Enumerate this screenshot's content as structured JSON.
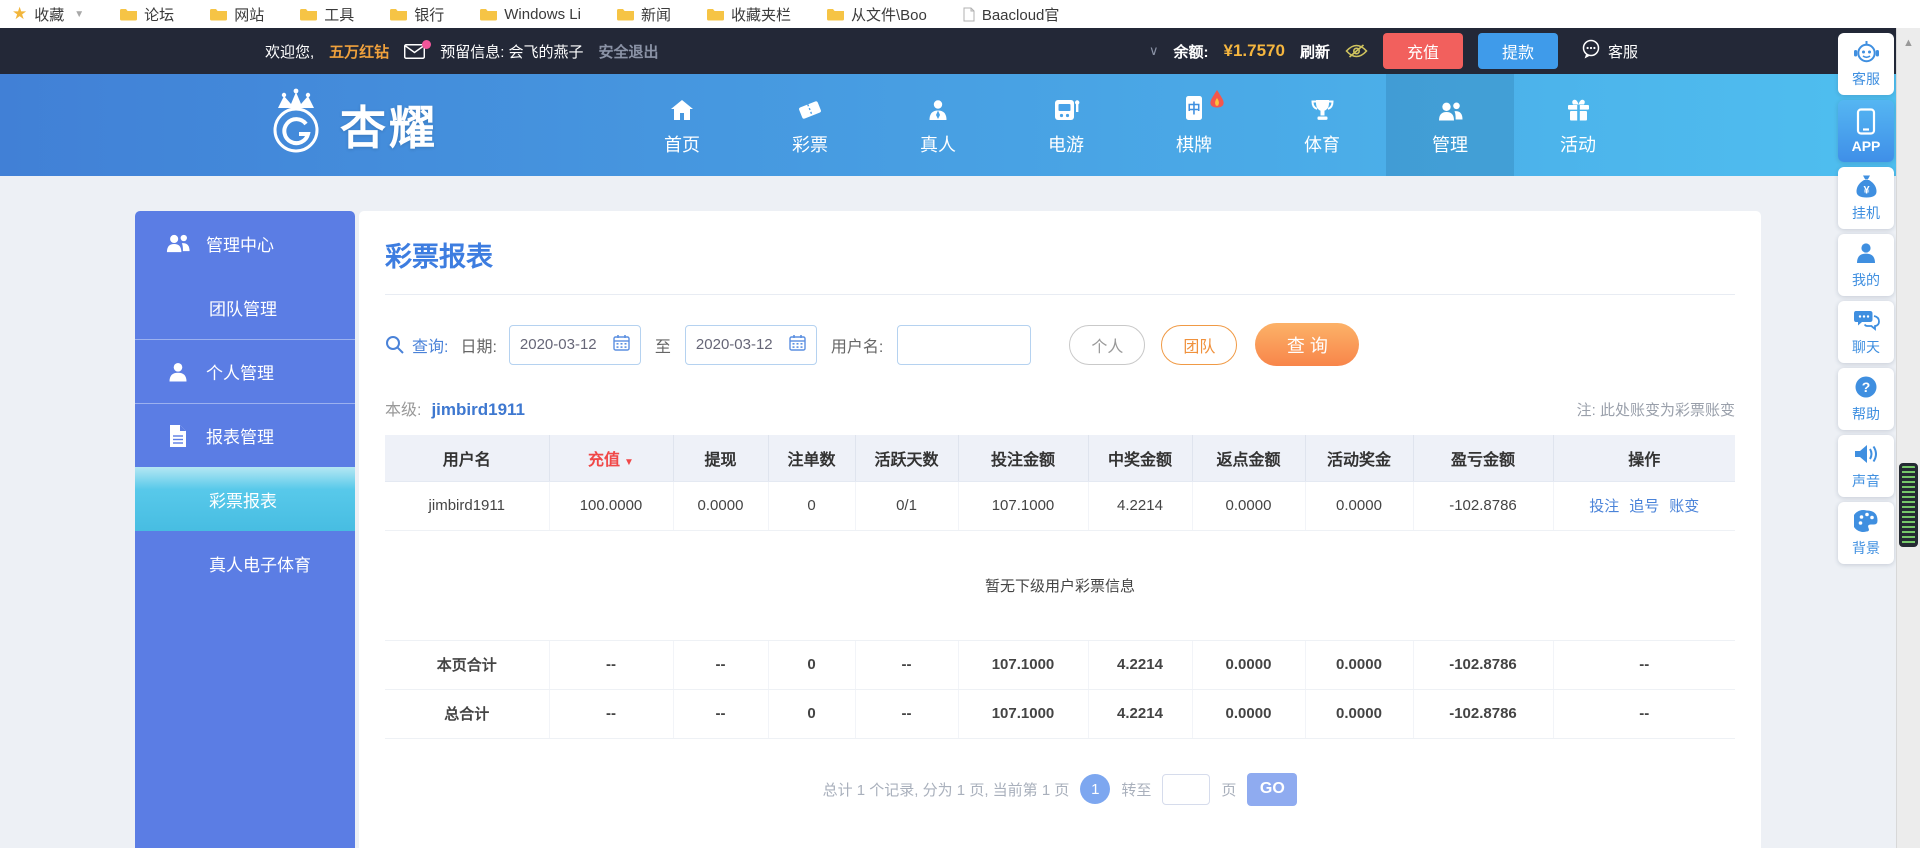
{
  "bookmarks": {
    "star_item": "收藏",
    "folders": [
      "论坛",
      "网站",
      "工具",
      "银行",
      "Windows Li",
      "新闻",
      "收藏夹栏",
      "从文件\\Boo"
    ],
    "page_item": "Baacloud官",
    "folder_icon": "folder-icon",
    "page_icon": "page-icon"
  },
  "topbar": {
    "welcome": "欢迎您,",
    "vip": "五万红钻",
    "mail_icon": "envelope-icon",
    "reserved": "预留信息: 会飞的燕子",
    "logout": "安全退出",
    "chevron_icon": "chevron-down-icon",
    "balance_label": "余额:",
    "balance_value": "¥1.7570",
    "refresh": "刷新",
    "eye_icon": "eye-slash-icon",
    "recharge": "充值",
    "withdraw": "提款",
    "service": "客服",
    "service_icon": "chat-bubble-icon",
    "colors": {
      "recharge": "#f2605d",
      "withdraw": "#3f9bea",
      "balance": "#f5b63f"
    }
  },
  "nav": {
    "logo_text": "杏耀",
    "logo_icon": "crown-emblem-icon",
    "items": [
      {
        "id": "home",
        "label": "首页",
        "icon": "home-icon"
      },
      {
        "id": "lottery",
        "label": "彩票",
        "icon": "ticket-icon"
      },
      {
        "id": "live",
        "label": "真人",
        "icon": "dealer-icon"
      },
      {
        "id": "egame",
        "label": "电游",
        "icon": "slot-icon"
      },
      {
        "id": "board",
        "label": "棋牌",
        "icon": "mahjong-icon",
        "badge": "hot-flame-icon"
      },
      {
        "id": "sports",
        "label": "体育",
        "icon": "trophy-icon"
      },
      {
        "id": "manage",
        "label": "管理",
        "icon": "team-icon",
        "active": true
      },
      {
        "id": "activity",
        "label": "活动",
        "icon": "gift-icon"
      }
    ]
  },
  "sidebar": {
    "items": [
      {
        "id": "manage-center",
        "label": "管理中心",
        "icon": "team-icon",
        "type": "group"
      },
      {
        "id": "team-manage",
        "label": "团队管理",
        "type": "sub"
      },
      {
        "id": "personal-manage",
        "label": "个人管理",
        "icon": "person-icon",
        "type": "group",
        "divided": true
      },
      {
        "id": "report-manage",
        "label": "报表管理",
        "icon": "report-icon",
        "type": "group",
        "divided": true
      },
      {
        "id": "lottery-report",
        "label": "彩票报表",
        "type": "sub",
        "active": true
      },
      {
        "id": "live-esports",
        "label": "真人电子体育",
        "type": "sub"
      }
    ]
  },
  "floatbar": {
    "items": [
      {
        "id": "service",
        "label": "客服",
        "icon": "service-robot-icon"
      },
      {
        "id": "app",
        "label": "APP",
        "icon": "phone-icon",
        "active": true
      },
      {
        "id": "hangup",
        "label": "挂机",
        "icon": "moneybag-icon"
      },
      {
        "id": "mine",
        "label": "我的",
        "icon": "user-icon"
      },
      {
        "id": "chat",
        "label": "聊天",
        "icon": "chat-bubbles-icon"
      },
      {
        "id": "help",
        "label": "帮助",
        "icon": "help-icon"
      },
      {
        "id": "sound",
        "label": "声音",
        "icon": "sound-icon"
      },
      {
        "id": "background",
        "label": "背景",
        "icon": "palette-icon"
      }
    ]
  },
  "main": {
    "title": "彩票报表",
    "search": {
      "search_icon": "search-icon",
      "calendar_icon": "calendar-icon",
      "query_label": "查询:",
      "date_label": "日期:",
      "date_from": "2020-03-12",
      "to_label": "至",
      "date_to": "2020-03-12",
      "username_label": "用户名:",
      "username_value": "",
      "personal_btn": "个人",
      "team_btn": "团队",
      "search_btn": "查 询"
    },
    "level_label": "本级:",
    "level_user": "jimbird1911",
    "note": "注: 此处账变为彩票账变",
    "table": {
      "headers": [
        "用户名",
        "充值",
        "提现",
        "注单数",
        "活跃天数",
        "投注金额",
        "中奖金额",
        "返点金额",
        "活动奖金",
        "盈亏金额",
        "操作"
      ],
      "sort_header_index": 1,
      "rows": [
        {
          "user": "jimbird1911",
          "cells": [
            "100.0000",
            "0.0000",
            "0",
            "0/1",
            "107.1000",
            "4.2214",
            "0.0000",
            "0.0000"
          ],
          "profit": "-102.8786",
          "actions": [
            "投注",
            "追号",
            "账变"
          ]
        }
      ],
      "empty_text": "暂无下级用户彩票信息",
      "totals": [
        {
          "label": "本页合计",
          "cells": [
            "--",
            "--",
            "0",
            "--",
            "107.1000",
            "4.2214",
            "0.0000",
            "0.0000"
          ],
          "profit": "-102.8786",
          "ops": "--"
        },
        {
          "label": "总合计",
          "cells": [
            "--",
            "--",
            "0",
            "--",
            "107.1000",
            "4.2214",
            "0.0000",
            "0.0000"
          ],
          "profit": "-102.8786",
          "ops": "--"
        }
      ]
    },
    "pagination": {
      "summary": "总计 1 个记录, 分为 1 页, 当前第 1 页",
      "current_page": "1",
      "goto_label": "转至",
      "goto_value": "",
      "page_label": "页",
      "go_btn": "GO"
    }
  }
}
